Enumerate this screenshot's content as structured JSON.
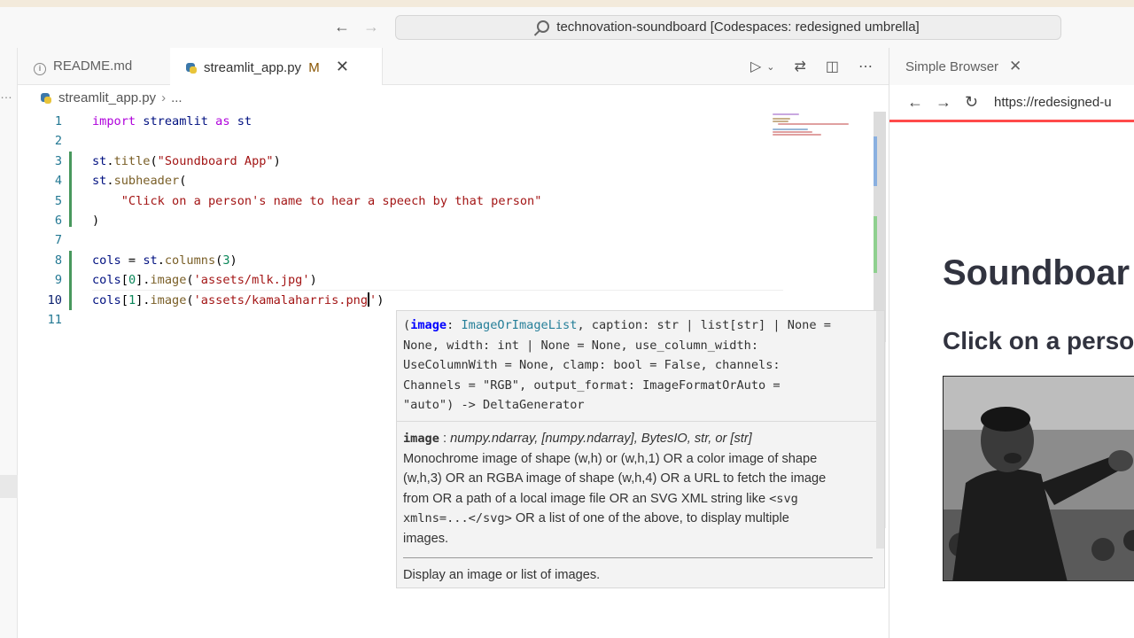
{
  "window": {
    "command_center": "technovation-soundboard [Codespaces: redesigned umbrella]"
  },
  "tabs": {
    "readme": "README.md",
    "app": "streamlit_app.py",
    "app_modified": "M"
  },
  "breadcrumb": {
    "file": "streamlit_app.py",
    "more": "..."
  },
  "editor": {
    "line_numbers": [
      "1",
      "2",
      "3",
      "4",
      "5",
      "6",
      "7",
      "8",
      "9",
      "10",
      "11"
    ],
    "active_line": 10
  },
  "hover": {
    "sig": {
      "p1": "image",
      "t1": "ImageOrImageList",
      "s1": ", caption: str | list[str] | None =",
      "l2": "None, width: int | None = None, use_column_width:",
      "l3": "UseColumnWith = None, clamp: bool = False, channels:",
      "l4": "Channels = \"RGB\", output_format: ImageFormatOrAuto =",
      "l5": "\"auto\") -> DeltaGenerator"
    },
    "param_name": "image",
    "param_sep": " : ",
    "param_type": "numpy.ndarray, [numpy.ndarray], BytesIO, str, or [str]",
    "desc1": "Monochrome image of shape (w,h) or (w,h,1) OR a color image of shape",
    "desc2": "(w,h,3) OR an RGBA image of shape (w,h,4) OR a URL to fetch the image",
    "desc3a": "from OR a path of a local image file OR an SVG XML string like ",
    "desc3b": "<svg",
    "desc4a": "xmlns=...</svg>",
    "desc4b": " OR a list of one of the above, to display multiple",
    "desc5": "images.",
    "summary": "Display an image or list of images."
  },
  "simple_browser": {
    "tab": "Simple Browser",
    "url": "https://redesigned-u",
    "page_title": "Soundboar",
    "page_subheader": "Click on a person"
  },
  "colors": {
    "streamlit_accent": "#ff4b4b",
    "modified": "#895503",
    "added_gutter": "#48985d"
  }
}
